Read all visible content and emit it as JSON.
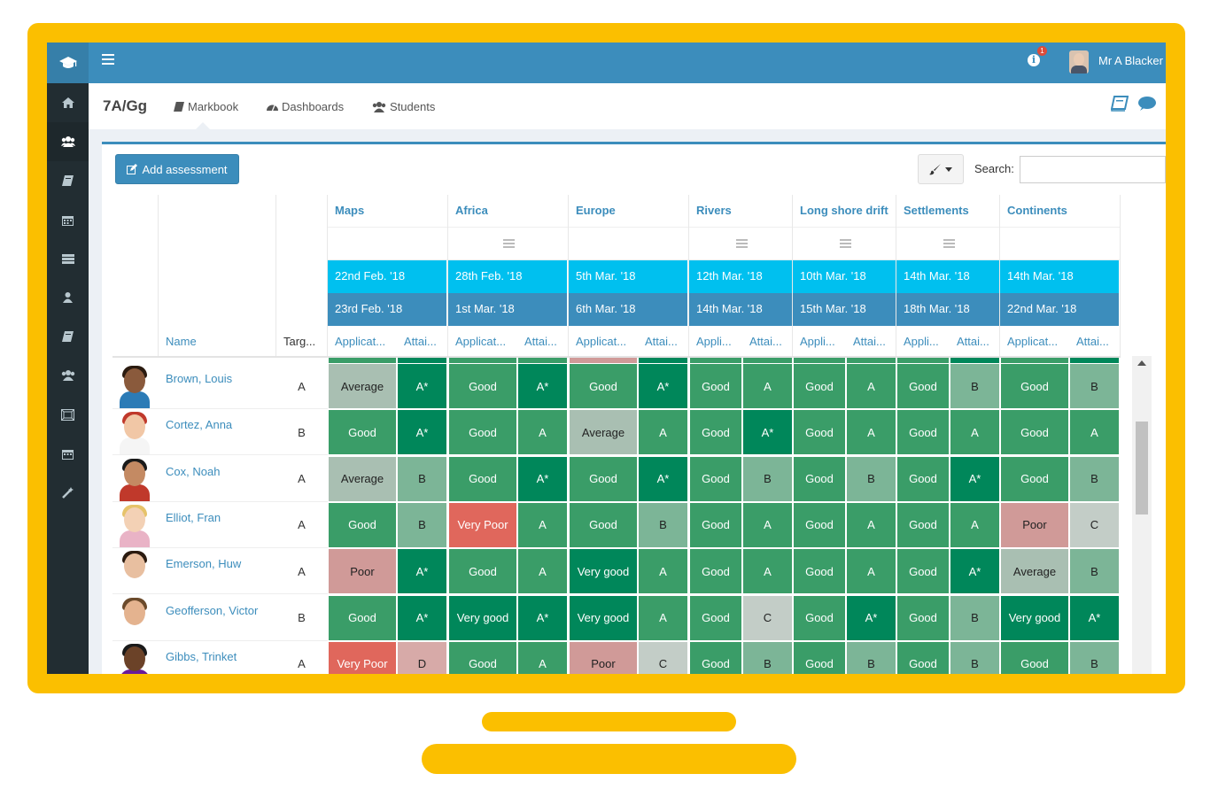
{
  "app": {
    "user_name": "Mr A Blacker",
    "notification_count": "1"
  },
  "header": {
    "class_title": "7A/Gg",
    "tabs": [
      {
        "label": "Markbook"
      },
      {
        "label": "Dashboards"
      },
      {
        "label": "Students"
      }
    ]
  },
  "toolbar": {
    "add_label": "Add assessment",
    "search_label": "Search:",
    "search_value": ""
  },
  "columns": {
    "name_header": "Name",
    "target_header": "Targ..."
  },
  "assessments": [
    {
      "name": "Maps",
      "date1": "22nd Feb. '18",
      "date2": "23rd Feb. '18",
      "sub_app": "Applicat...",
      "sub_att": "Attai...",
      "has_settings": false
    },
    {
      "name": "Africa",
      "date1": "28th Feb. '18",
      "date2": "1st Mar. '18",
      "sub_app": "Applicat...",
      "sub_att": "Attai...",
      "has_settings": true
    },
    {
      "name": "Europe",
      "date1": "5th Mar. '18",
      "date2": "6th Mar. '18",
      "sub_app": "Applicat...",
      "sub_att": "Attai...",
      "has_settings": false
    },
    {
      "name": "Rivers",
      "date1": "12th Mar. '18",
      "date2": "14th Mar. '18",
      "sub_app": "Appli...",
      "sub_att": "Attai...",
      "has_settings": true
    },
    {
      "name": "Long shore drift",
      "date1": "10th Mar. '18",
      "date2": "15th Mar. '18",
      "sub_app": "Appli...",
      "sub_att": "Attai...",
      "has_settings": true
    },
    {
      "name": "Settlements",
      "date1": "14th Mar. '18",
      "date2": "18th Mar. '18",
      "sub_app": "Appli...",
      "sub_att": "Attai...",
      "has_settings": true
    },
    {
      "name": "Continents",
      "date1": "14th Mar. '18",
      "date2": "22nd Mar. '18",
      "sub_app": "Applicat...",
      "sub_att": "Attai...",
      "has_settings": false
    }
  ],
  "students": [
    {
      "name": "Brown, Louis",
      "target": "A",
      "grades": [
        "Average",
        "A*",
        "Good",
        "A*",
        "Good",
        "A*",
        "Good",
        "A",
        "Good",
        "A",
        "Good",
        "B",
        "Good",
        "B"
      ]
    },
    {
      "name": "Cortez, Anna",
      "target": "B",
      "grades": [
        "Good",
        "A*",
        "Good",
        "A",
        "Average",
        "A",
        "Good",
        "A*",
        "Good",
        "A",
        "Good",
        "A",
        "Good",
        "A"
      ]
    },
    {
      "name": "Cox, Noah",
      "target": "A",
      "grades": [
        "Average",
        "B",
        "Good",
        "A*",
        "Good",
        "A*",
        "Good",
        "B",
        "Good",
        "B",
        "Good",
        "A*",
        "Good",
        "B"
      ]
    },
    {
      "name": "Elliot, Fran",
      "target": "A",
      "grades": [
        "Good",
        "B",
        "Very Poor",
        "A",
        "Good",
        "B",
        "Good",
        "A",
        "Good",
        "A",
        "Good",
        "A",
        "Poor",
        "C"
      ]
    },
    {
      "name": "Emerson, Huw",
      "target": "A",
      "grades": [
        "Poor",
        "A*",
        "Good",
        "A",
        "Very good",
        "A",
        "Good",
        "A",
        "Good",
        "A",
        "Good",
        "A*",
        "Average",
        "B"
      ]
    },
    {
      "name": "Geofferson, Victor",
      "target": "B",
      "grades": [
        "Good",
        "A*",
        "Very good",
        "A*",
        "Very good",
        "A",
        "Good",
        "C",
        "Good",
        "A*",
        "Good",
        "B",
        "Very good",
        "A*"
      ]
    },
    {
      "name": "Gibbs, Trinket",
      "target": "A",
      "grades": [
        "Very Poor",
        "D",
        "Good",
        "A",
        "Poor",
        "C",
        "Good",
        "B",
        "Good",
        "B",
        "Good",
        "B",
        "Good",
        "B"
      ]
    }
  ],
  "grade_colors": {
    "Very good": {
      "bg": "#00875a",
      "fg": "#ffffff"
    },
    "Good": {
      "bg": "#3a9d68",
      "fg": "#ffffff"
    },
    "Average": {
      "bg": "#a9bfb2",
      "fg": "#222222"
    },
    "Poor": {
      "bg": "#d09a98",
      "fg": "#222222"
    },
    "Very Poor": {
      "bg": "#e0675c",
      "fg": "#ffffff"
    },
    "A*": {
      "bg": "#00875a",
      "fg": "#ffffff"
    },
    "A": {
      "bg": "#3a9d68",
      "fg": "#ffffff"
    },
    "B": {
      "bg": "#7cb597",
      "fg": "#222222"
    },
    "C": {
      "bg": "#c3cdc7",
      "fg": "#222222"
    },
    "D": {
      "bg": "#d7aaa8",
      "fg": "#222222"
    }
  },
  "icons": {
    "logo": "graduation-cap-icon",
    "menu": "hamburger-icon",
    "info": "info-icon",
    "sidebar": [
      "home-icon",
      "users-icon",
      "book-icon",
      "calendar-icon",
      "list-icon",
      "user-icon",
      "book-icon",
      "users-icon",
      "grid-icon",
      "calendar-icon",
      "magic-icon"
    ]
  }
}
